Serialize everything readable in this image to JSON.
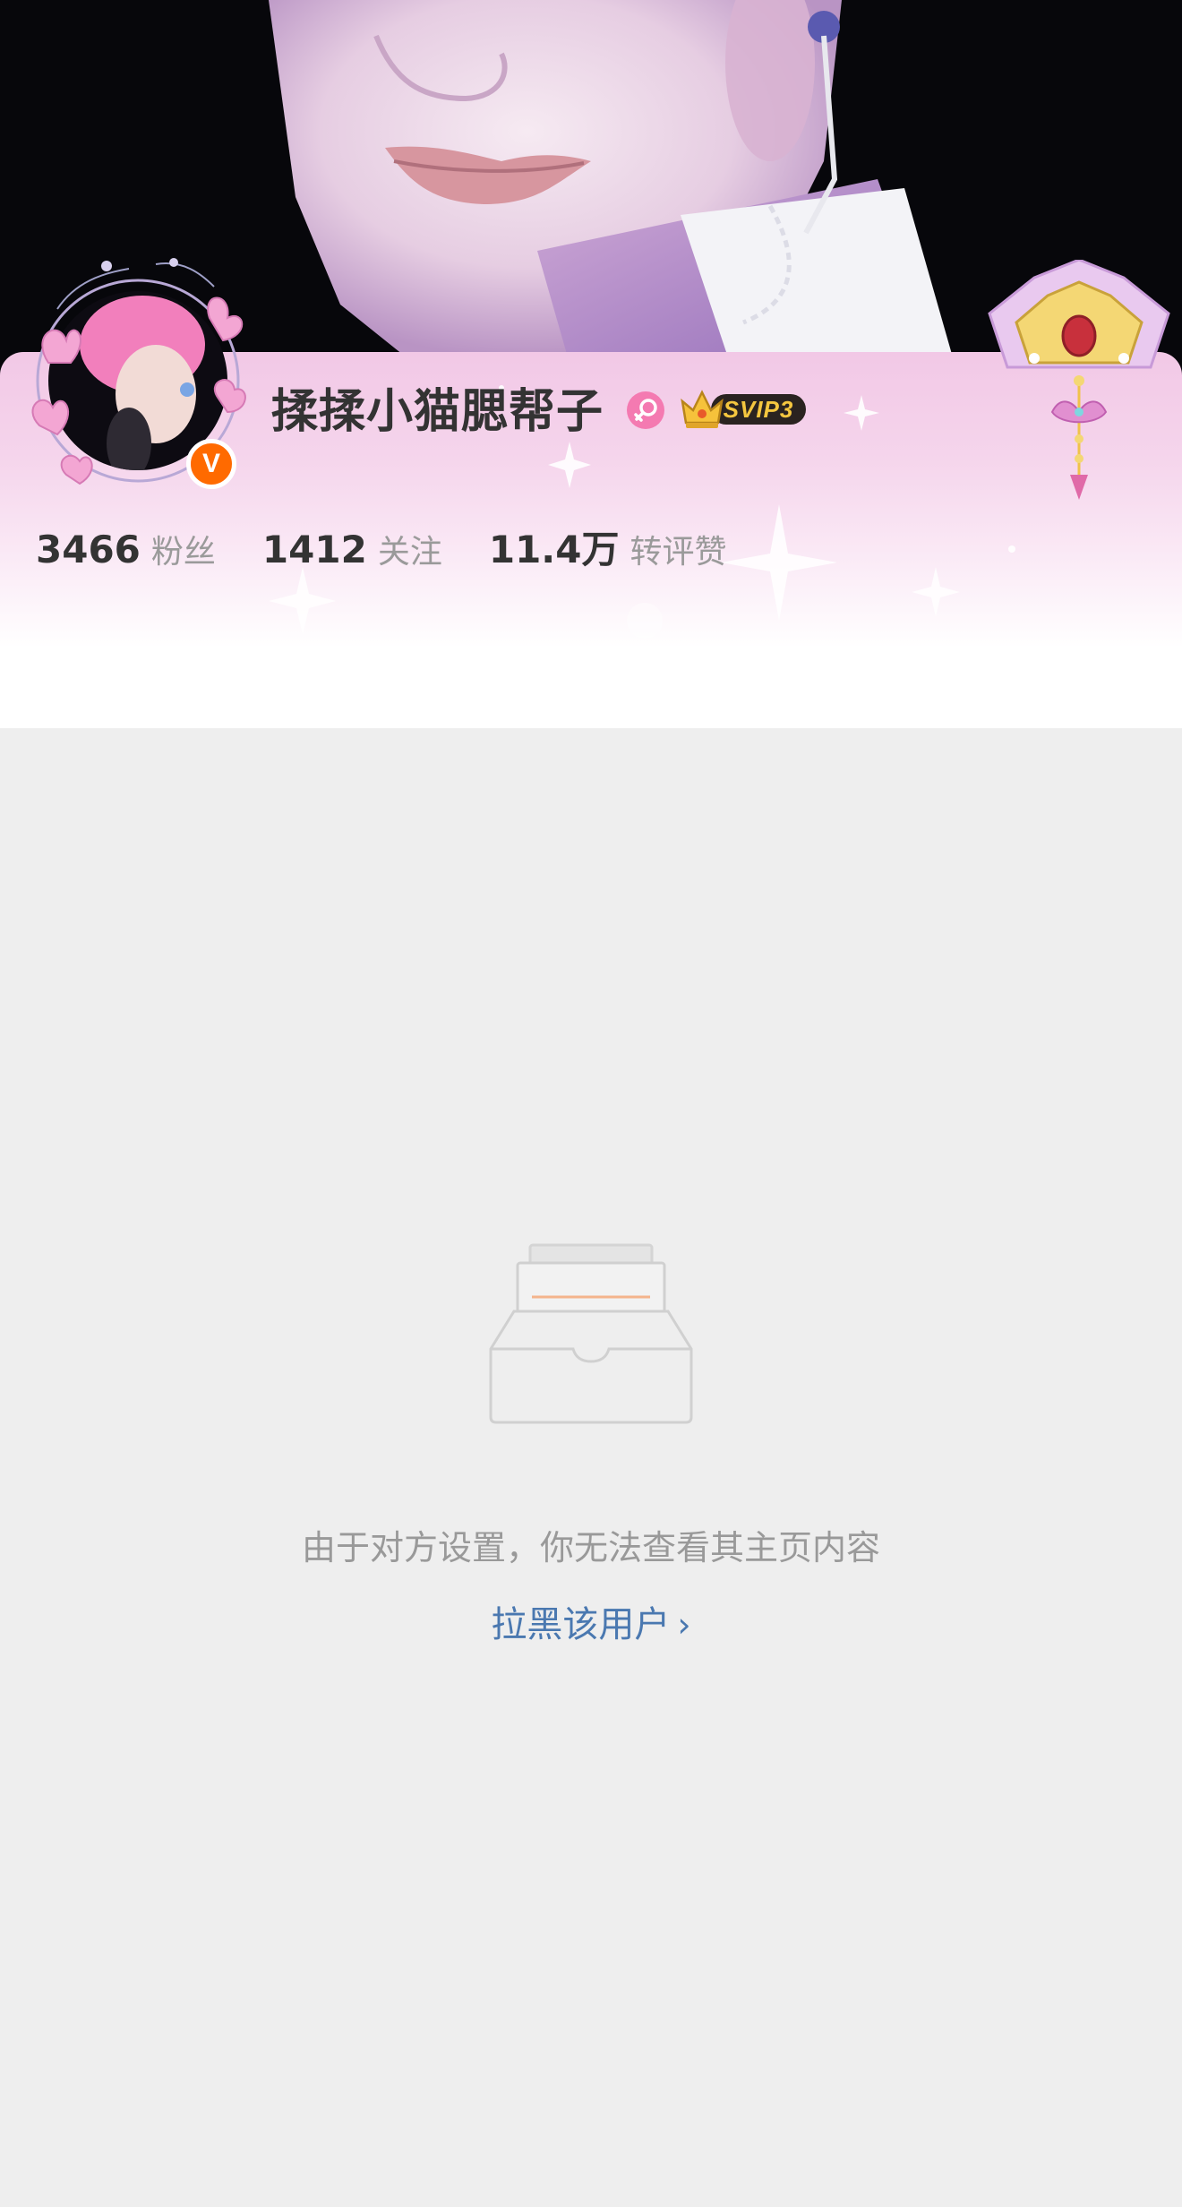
{
  "profile": {
    "username": "揉揉小猫腮帮子",
    "vip_level": "SVIP3"
  },
  "stats": [
    {
      "value": "3466",
      "label": "粉丝"
    },
    {
      "value": "1412",
      "label": "关注"
    },
    {
      "value": "11.4万",
      "label": "转评赞"
    }
  ],
  "empty_state": {
    "message": "由于对方设置，你无法查看其主页内容",
    "action_label": "拉黑该用户",
    "action_chevron": "›"
  },
  "icons": {
    "gender": "female-icon",
    "verified": "verified-v-icon",
    "vip": "crown-icon",
    "empty": "empty-inbox-icon"
  },
  "colors": {
    "accent_link": "#4a78b0",
    "verified": "#ff6a00",
    "card_pink": "#f2c8e6",
    "gender_pink": "#f47ab1",
    "background": "#eeeeee"
  }
}
